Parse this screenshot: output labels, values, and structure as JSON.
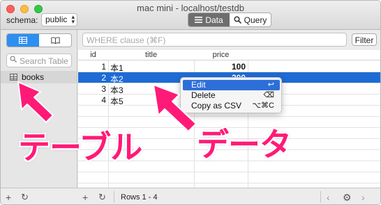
{
  "window": {
    "title": "mac mini - localhost/testdb"
  },
  "toolbar": {
    "schema_label": "schema:",
    "schema_value": "public",
    "view_tabs": [
      {
        "label": "Data",
        "icon": "list-icon",
        "active": true
      },
      {
        "label": "Query",
        "icon": "search-icon",
        "active": false
      }
    ]
  },
  "sidebar": {
    "view_toggle": [
      {
        "icon": "grid-icon",
        "active": true
      },
      {
        "icon": "book-icon",
        "active": false
      }
    ],
    "search_placeholder": "Search Table",
    "tables": [
      {
        "label": "books",
        "icon": "table-icon"
      }
    ]
  },
  "filter": {
    "placeholder": "WHERE clause (⌘F)",
    "button_label": "Filter"
  },
  "grid": {
    "columns": [
      "id",
      "title",
      "price"
    ],
    "rows": [
      {
        "id": "1",
        "title": "本1",
        "price": "100"
      },
      {
        "id": "2",
        "title": "本2",
        "price": "200",
        "selected": true
      },
      {
        "id": "3",
        "title": "本3",
        "price": ""
      },
      {
        "id": "4",
        "title": "本5",
        "price": ""
      }
    ]
  },
  "context_menu": {
    "items": [
      {
        "label": "Edit",
        "shortcut": "↩",
        "highlighted": true
      },
      {
        "label": "Delete",
        "shortcut": "⌫"
      },
      {
        "label": "Copy as CSV",
        "shortcut": "⌥⌘C"
      }
    ]
  },
  "footer": {
    "rows_label": "Rows 1 - 4"
  },
  "annotations": {
    "table_label": "テーブル",
    "data_label": "データ",
    "color": "#ff1a77"
  },
  "colors": {
    "selection": "#1e6bd6",
    "accent": "#2d8ff0"
  }
}
